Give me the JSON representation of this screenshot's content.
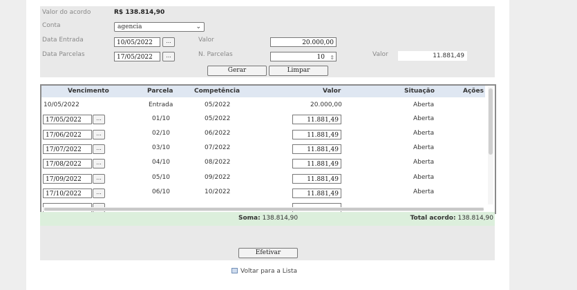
{
  "form": {
    "valor_acordo_label": "Valor do acordo",
    "valor_acordo_value": "R$ 138.814,90",
    "conta_label": "Conta",
    "conta_value": "agencia",
    "data_entrada_label": "Data Entrada",
    "data_entrada_value": "10/05/2022",
    "valor_label": "Valor",
    "valor_value": "20.000,00",
    "data_parcelas_label": "Data Parcelas",
    "data_parcelas_value": "17/05/2022",
    "n_parcelas_label": "N. Parcelas",
    "n_parcelas_value": "10",
    "valor2_label": "Valor",
    "valor2_value": "11.881,49",
    "gerar_label": "Gerar",
    "limpar_label": "Limpar",
    "picker_label": "..."
  },
  "table": {
    "headers": {
      "vencimento": "Vencimento",
      "parcela": "Parcela",
      "competencia": "Competência",
      "valor": "Valor",
      "situacao": "Situação",
      "acoes": "Ações"
    },
    "first_row": {
      "vencimento": "10/05/2022",
      "parcela": "Entrada",
      "competencia": "05/2022",
      "valor": "20.000,00",
      "situacao": "Aberta"
    },
    "rows": [
      {
        "vencimento": "17/05/2022",
        "parcela": "01/10",
        "competencia": "05/2022",
        "valor": "11.881,49",
        "situacao": "Aberta"
      },
      {
        "vencimento": "17/06/2022",
        "parcela": "02/10",
        "competencia": "06/2022",
        "valor": "11.881,49",
        "situacao": "Aberta"
      },
      {
        "vencimento": "17/07/2022",
        "parcela": "03/10",
        "competencia": "07/2022",
        "valor": "11.881,49",
        "situacao": "Aberta"
      },
      {
        "vencimento": "17/08/2022",
        "parcela": "04/10",
        "competencia": "08/2022",
        "valor": "11.881,49",
        "situacao": "Aberta"
      },
      {
        "vencimento": "17/09/2022",
        "parcela": "05/10",
        "competencia": "09/2022",
        "valor": "11.881,49",
        "situacao": "Aberta"
      },
      {
        "vencimento": "17/10/2022",
        "parcela": "06/10",
        "competencia": "10/2022",
        "valor": "11.881,49",
        "situacao": "Aberta"
      }
    ]
  },
  "summary": {
    "soma_label": "Soma:",
    "soma_value": "138.814,90",
    "total_label": "Total acordo:",
    "total_value": "138.814,90"
  },
  "actions": {
    "efetivar_label": "Efetivar",
    "voltar_label": "Voltar para a Lista"
  }
}
